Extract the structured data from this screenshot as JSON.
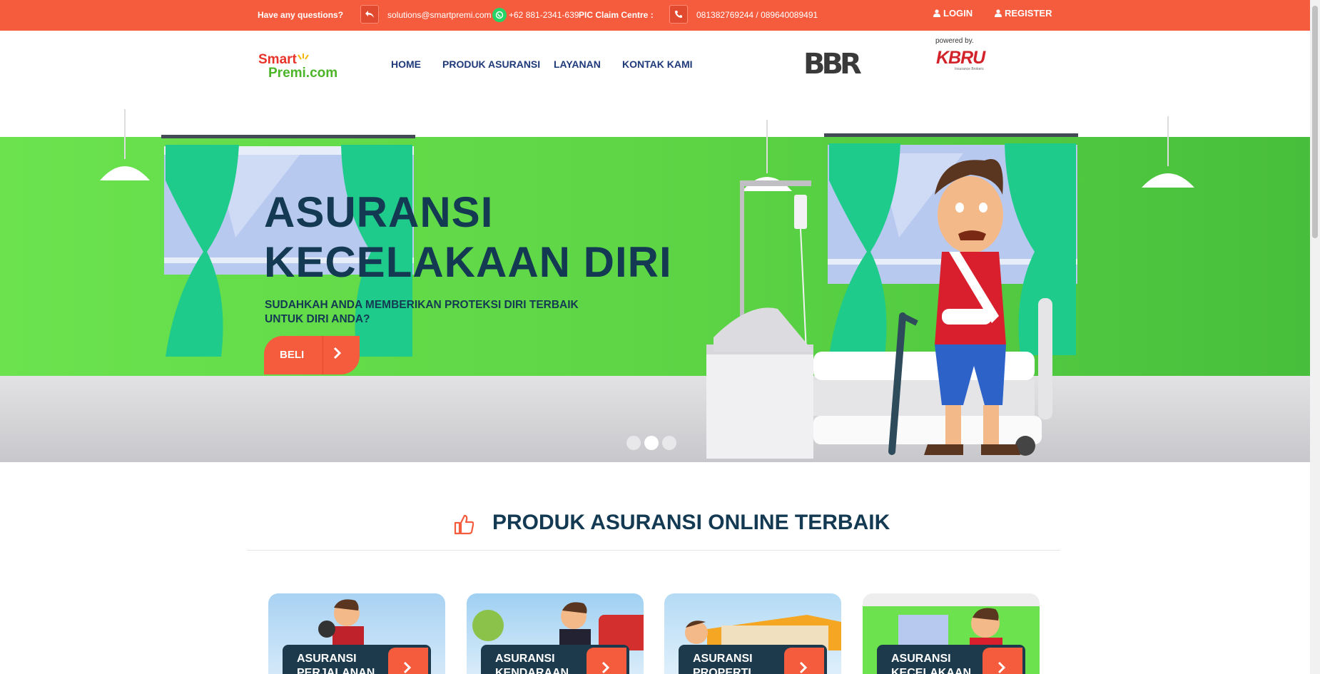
{
  "topbar": {
    "question": "Have any questions?",
    "email": "solutions@smartpremi.com",
    "whatsapp": "+62 881-2341-639",
    "claim_label": "PIC Claim Centre :",
    "claim_phones": "081382769244 / 089640089491",
    "login": "LOGIN",
    "register": "REGISTER"
  },
  "nav": {
    "logo_top": "Smart",
    "logo_bottom": "Premi.com",
    "items": [
      "HOME",
      "PRODUK ASURANSI",
      "LAYANAN",
      "KONTAK KAMI"
    ],
    "partner_logo": "BBR",
    "powered_by": "powered by.",
    "kbru_logo": "KBRU",
    "kbru_sub": "Insurance Brokers"
  },
  "hero": {
    "title_line1": "ASURANSI",
    "title_line2": "KECELAKAAN DIRI",
    "subtitle": "SUDAHKAH ANDA MEMBERIKAN PROTEKSI DIRI TERBAIK UNTUK DIRI ANDA?",
    "button": "BELI",
    "slides_total": 3,
    "active_slide": 2
  },
  "products": {
    "title": "PRODUK ASURANSI ONLINE TERBAIK",
    "cards": [
      {
        "title": "ASURANSI PERJALANAN"
      },
      {
        "title": "ASURANSI KENDARAAN"
      },
      {
        "title": "ASURANSI PROPERTI"
      },
      {
        "title": "ASURANSI KECELAKAAN"
      }
    ]
  },
  "colors": {
    "accent": "#f55c3e",
    "navy": "#133a52",
    "green": "#5dd545",
    "nav_text": "#1f3a7a"
  }
}
